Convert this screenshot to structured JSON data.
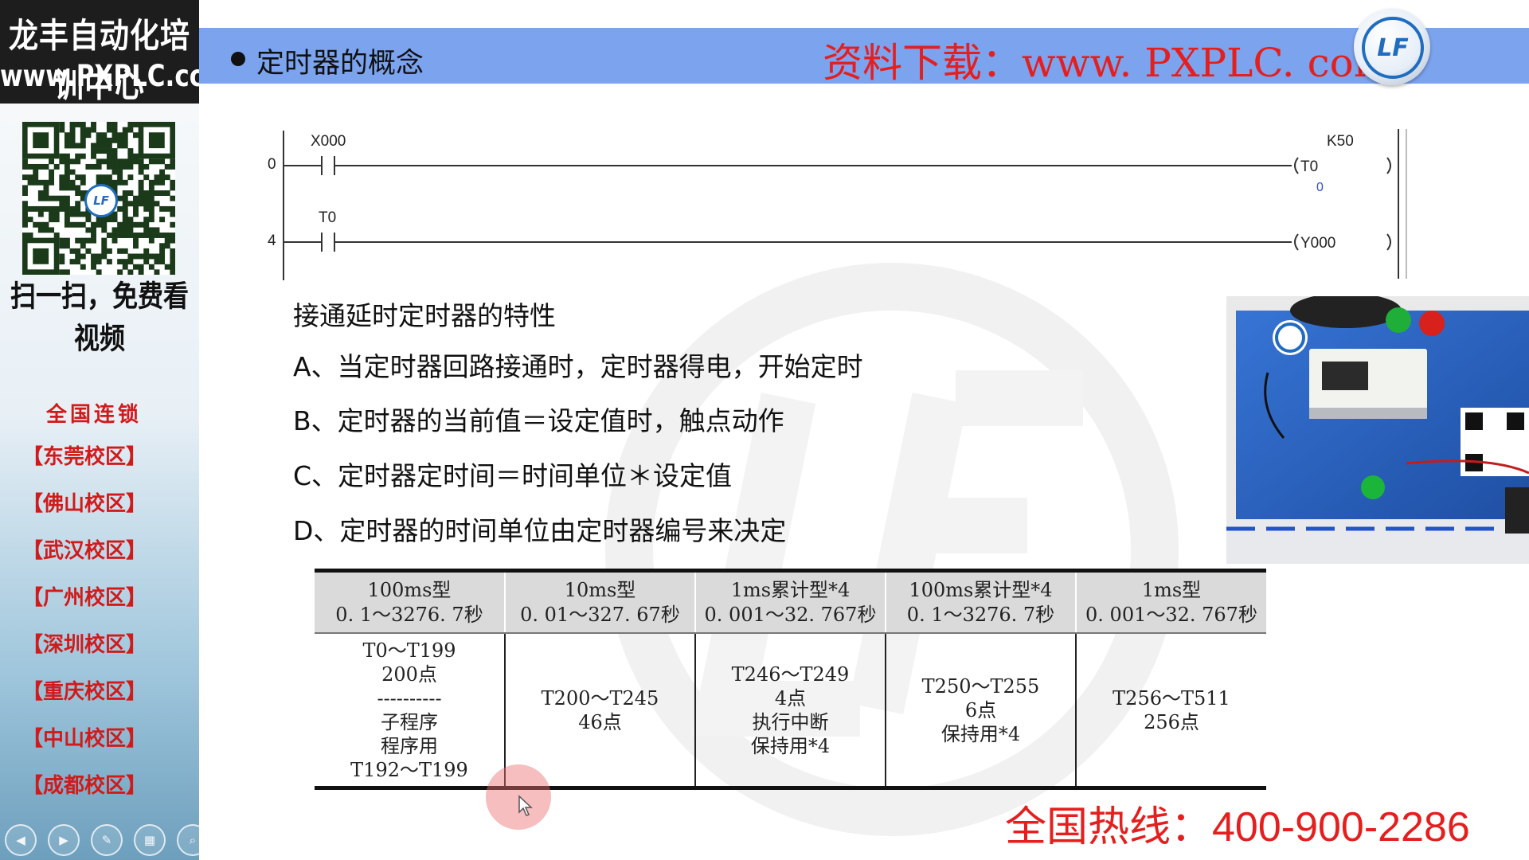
{
  "sidebar": {
    "brand_name": "龙丰自动化培训中心",
    "brand_url": "www.PXPLC.com",
    "qr_logo": "LF",
    "qr_caption": "扫一扫，免费看视频",
    "network_title": "全国连锁",
    "campuses": [
      "【东莞校区】",
      "【佛山校区】",
      "【武汉校区】",
      "【广州校区】",
      "【深圳校区】",
      "【重庆校区】",
      "【中山校区】",
      "【成都校区】"
    ],
    "toolbar_icons": [
      "prev-icon",
      "play-icon",
      "pen-icon",
      "slides-icon",
      "zoom-icon",
      "more-icon"
    ]
  },
  "header": {
    "title": "定时器的概念",
    "download_banner": "资料下载：www. PXPLC. com",
    "logo_text": "LF",
    "bar_color": "#7ba3ee",
    "banner_color": "#e51e1e"
  },
  "ladder": {
    "rungs": [
      {
        "step": "0",
        "contact": "X000",
        "coil": "T0",
        "setpoint": "K50",
        "current_value": "0"
      },
      {
        "step": "4",
        "contact": "T0",
        "coil": "Y000"
      }
    ]
  },
  "characteristics": {
    "title": "接通延时定时器的特性",
    "items": [
      "A、当定时器回路接通时，定时器得电，开始定时",
      "B、定时器的当前值＝设定值时，触点动作",
      "C、定时器定时间＝时间单位＊设定值",
      "D、定时器的时间单位由定时器编号来决定"
    ]
  },
  "timer_table": {
    "columns": [
      {
        "type": "100ms型",
        "range": "0. 1～3276. 7秒",
        "cell": [
          "T0～T199",
          "200点",
          "----------",
          "子程序",
          "程序用",
          "T192～T199"
        ]
      },
      {
        "type": "10ms型",
        "range": "0. 01～327. 67秒",
        "cell": [
          "T200～T245",
          "46点"
        ]
      },
      {
        "type": "1ms累计型*4",
        "range": "0. 001～32. 767秒",
        "cell": [
          "T246～T249",
          "4点",
          "执行中断",
          "保持用*4"
        ]
      },
      {
        "type": "100ms累计型*4",
        "range": "0. 1～3276. 7秒",
        "cell": [
          "T250～T255",
          "6点",
          "保持用*4"
        ]
      },
      {
        "type": "1ms型",
        "range": "0. 001～32. 767秒",
        "cell": [
          "T256～T511",
          "256点"
        ]
      }
    ]
  },
  "footer": {
    "hotline_label": "全国热线：",
    "hotline_number": "400-900-2286",
    "color": "#e51e1e"
  }
}
